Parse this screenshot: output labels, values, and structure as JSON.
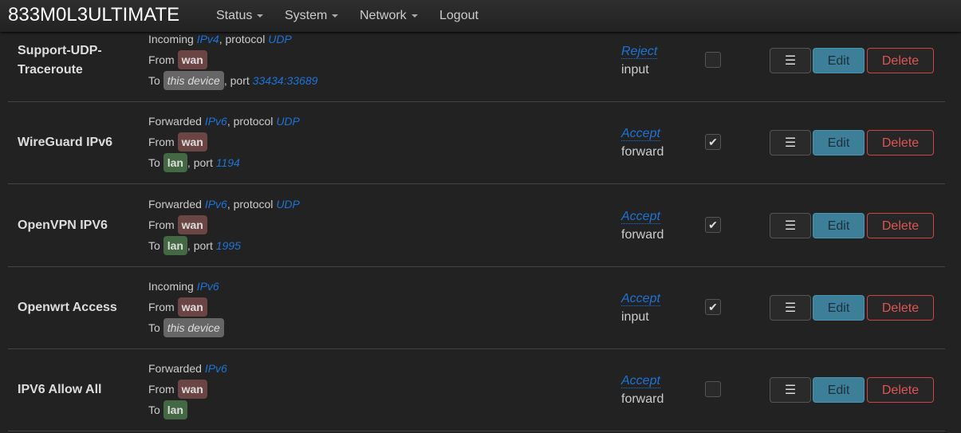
{
  "header": {
    "brand": "833M0L3ULTIMATE",
    "nav": [
      {
        "label": "Status",
        "dropdown": true
      },
      {
        "label": "System",
        "dropdown": true
      },
      {
        "label": "Network",
        "dropdown": true
      },
      {
        "label": "Logout",
        "dropdown": false
      }
    ]
  },
  "buttons": {
    "menu": "☰",
    "edit": "Edit",
    "delete": "Delete"
  },
  "rules": [
    {
      "name": "Support-UDP-Traceroute",
      "dir": "Incoming",
      "family": "IPv4",
      "protocol": "UDP",
      "from_label": "From",
      "from": "wan",
      "to_label": "To",
      "to": "this device",
      "port": "33434:33689",
      "action": "Reject",
      "chain": "input",
      "enabled": false
    },
    {
      "name": "WireGuard IPv6",
      "dir": "Forwarded",
      "family": "IPv6",
      "protocol": "UDP",
      "from_label": "From",
      "from": "wan",
      "to_label": "To",
      "to": "lan",
      "port": "1194",
      "action": "Accept",
      "chain": "forward",
      "enabled": true
    },
    {
      "name": "OpenVPN IPV6",
      "dir": "Forwarded",
      "family": "IPv6",
      "protocol": "UDP",
      "from_label": "From",
      "from": "wan",
      "to_label": "To",
      "to": "lan",
      "port": "1995",
      "action": "Accept",
      "chain": "forward",
      "enabled": true
    },
    {
      "name": "Openwrt Access",
      "dir": "Incoming",
      "family": "IPv6",
      "protocol": null,
      "from_label": "From",
      "from": "wan",
      "to_label": "To",
      "to": "this device",
      "port": null,
      "action": "Accept",
      "chain": "input",
      "enabled": true
    },
    {
      "name": "IPV6 Allow All",
      "dir": "Forwarded",
      "family": "IPv6",
      "protocol": null,
      "from_label": "From",
      "from": "wan",
      "to_label": "To",
      "to": "lan",
      "port": null,
      "action": "Accept",
      "chain": "forward",
      "enabled": false
    }
  ],
  "strings": {
    "protocol": "protocol",
    "port": "port"
  },
  "colors": {
    "zone_wan": "#6b4444",
    "zone_lan": "#436843",
    "link": "#1e73d6",
    "edit": "#3d7f99",
    "delete": "#dd5555"
  }
}
